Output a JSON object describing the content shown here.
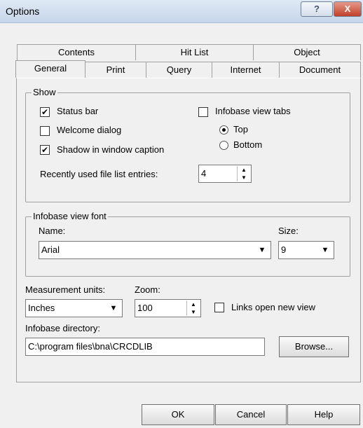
{
  "window": {
    "title": "Options",
    "help": "?",
    "close": "X"
  },
  "tabs": {
    "back": [
      "Contents",
      "Hit List",
      "Object"
    ],
    "front": [
      "General",
      "Print",
      "Query",
      "Internet",
      "Document"
    ],
    "active": "General"
  },
  "show": {
    "legend": "Show",
    "status_bar": "Status bar",
    "welcome_dialog": "Welcome dialog",
    "shadow": "Shadow in window caption",
    "infobase_tabs": "Infobase view tabs",
    "top": "Top",
    "bottom": "Bottom",
    "recent_label": "Recently used file list entries:",
    "recent_value": "4",
    "checked_mark": "✔"
  },
  "font": {
    "legend": "Infobase view font",
    "name_label": "Name:",
    "name_value": "Arial",
    "size_label": "Size:",
    "size_value": "9"
  },
  "units": {
    "label": "Measurement units:",
    "value": "Inches",
    "zoom_label": "Zoom:",
    "zoom_value": "100",
    "links_label": "Links open new view"
  },
  "dir": {
    "label": "Infobase directory:",
    "value": "C:\\program files\\bna\\CRCDLIB",
    "browse": "Browse..."
  },
  "buttons": {
    "ok": "OK",
    "cancel": "Cancel",
    "help": "Help"
  },
  "glyphs": {
    "arrow_down": "▼",
    "spin_up": "▲",
    "spin_down": "▼"
  }
}
